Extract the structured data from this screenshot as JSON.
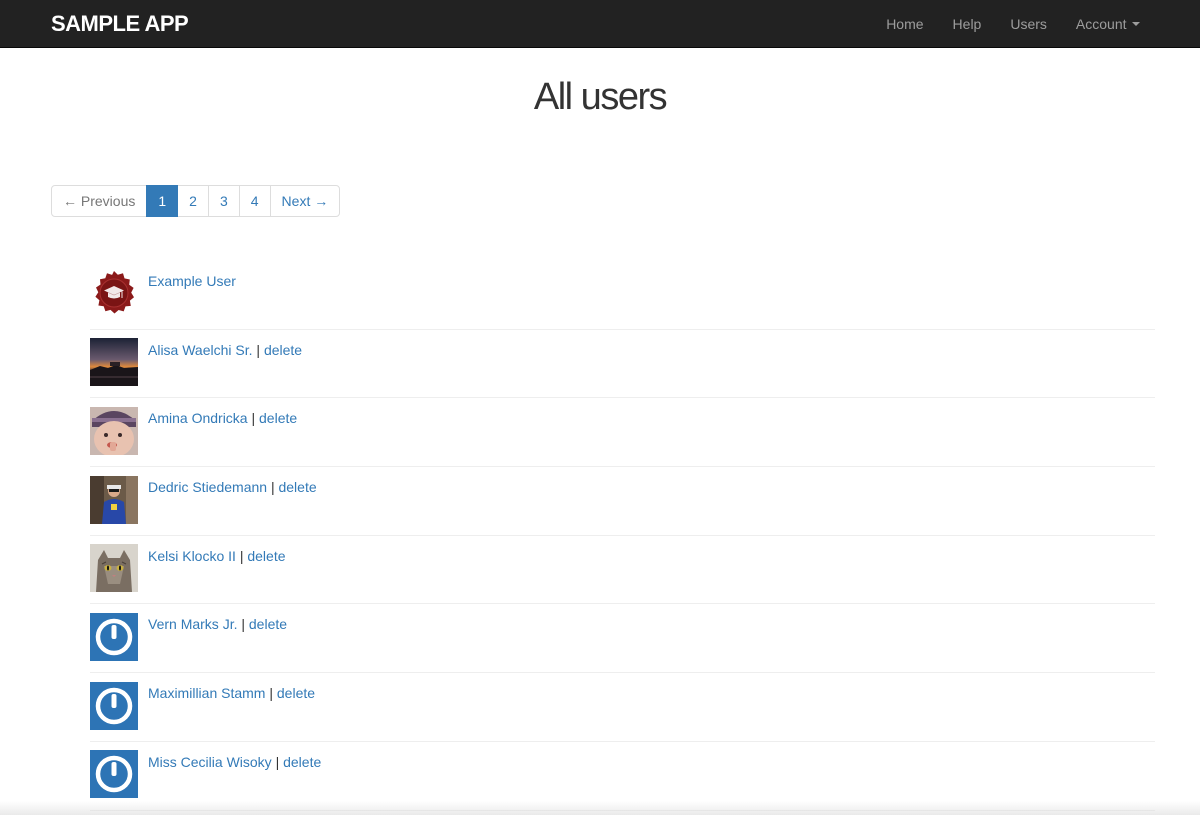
{
  "navbar": {
    "brand": "SAMPLE APP",
    "links": [
      {
        "label": "Home"
      },
      {
        "label": "Help"
      },
      {
        "label": "Users"
      },
      {
        "label": "Account"
      }
    ]
  },
  "page": {
    "title": "All users"
  },
  "pagination": {
    "previous": "← Previous",
    "pages": [
      "1",
      "2",
      "3",
      "4"
    ],
    "active_page": "1",
    "next": "Next →"
  },
  "users": [
    {
      "name": "Example User",
      "delete": "",
      "separator": "",
      "avatar": "badge-avatar"
    },
    {
      "name": "Alisa Waelchi Sr.",
      "separator": " | ",
      "delete": "delete",
      "avatar": "photo-sunset-avatar"
    },
    {
      "name": "Amina Ondricka",
      "separator": " | ",
      "delete": "delete",
      "avatar": "photo-baby-avatar"
    },
    {
      "name": "Dedric Stiedemann",
      "separator": " | ",
      "delete": "delete",
      "avatar": "photo-person-avatar"
    },
    {
      "name": "Kelsi Klocko II",
      "separator": " | ",
      "delete": "delete",
      "avatar": "photo-cat-avatar"
    },
    {
      "name": "Vern Marks Jr.",
      "separator": " | ",
      "delete": "delete",
      "avatar": "power-icon-avatar"
    },
    {
      "name": "Maximillian Stamm",
      "separator": " | ",
      "delete": "delete",
      "avatar": "power-icon-avatar"
    },
    {
      "name": "Miss Cecilia Wisoky",
      "separator": " | ",
      "delete": "delete",
      "avatar": "power-icon-avatar"
    }
  ],
  "colors": {
    "navbar_bg": "#222222",
    "link": "#337ab7",
    "active_page_bg": "#337ab7",
    "badge_red": "#8b1a1a",
    "gravatar_blue": "#2d74b5"
  }
}
